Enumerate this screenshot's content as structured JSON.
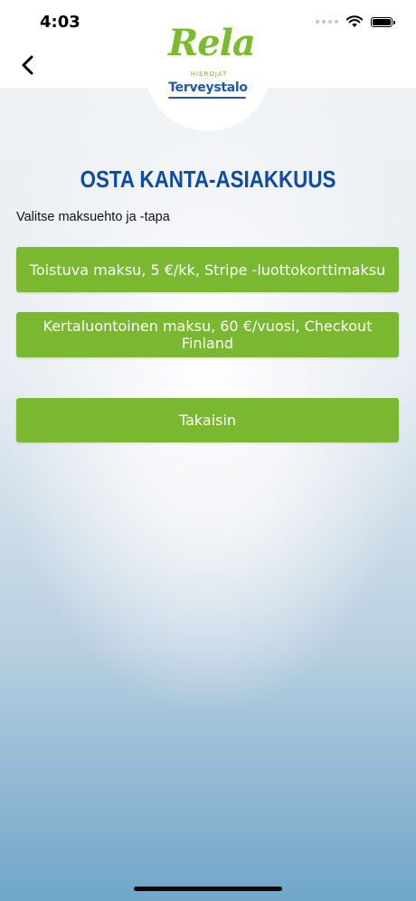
{
  "status_bar": {
    "time": "4:03"
  },
  "logo": {
    "brand": "Rela",
    "sub": "HIEROJAT",
    "company": "Terveystalo"
  },
  "page": {
    "title": "OSTA KANTA-ASIAKKUUS",
    "subtitle": "Valitse maksuehto ja -tapa"
  },
  "buttons": {
    "recurring": "Toistuva maksu, 5 €/kk, Stripe -luottokorttimaksu",
    "one_time": "Kertaluontoinen maksu, 60 €/vuosi, Checkout Finland",
    "back": "Takaisin"
  },
  "colors": {
    "accent_green": "#7ab832",
    "title_blue": "#0e4aa6"
  }
}
